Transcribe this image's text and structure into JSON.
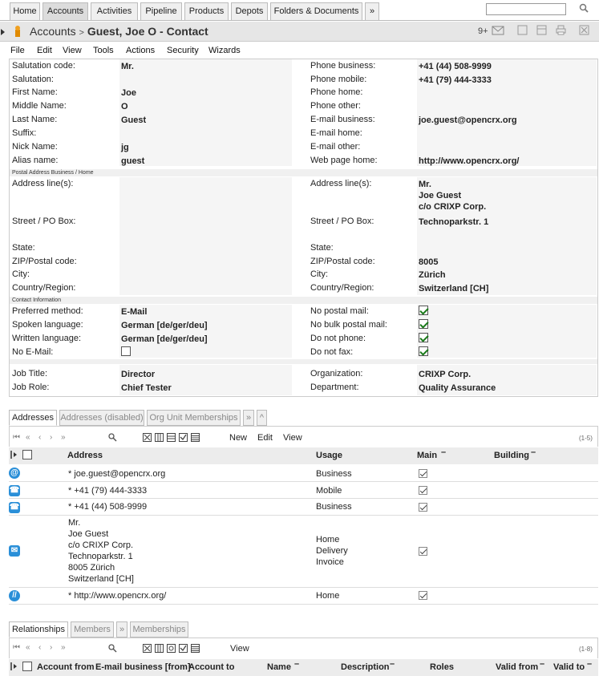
{
  "top_tabs": [
    {
      "label": "Home",
      "active": false
    },
    {
      "label": "Accounts",
      "active": true
    },
    {
      "label": "Activities",
      "active": false
    },
    {
      "label": "Pipeline",
      "active": false
    },
    {
      "label": "Products",
      "active": false
    },
    {
      "label": "Depots",
      "active": false
    },
    {
      "label": "Folders & Documents",
      "active": false
    },
    {
      "label": "»",
      "active": false
    }
  ],
  "search": {
    "value": "",
    "placeholder": ""
  },
  "breadcrumb": {
    "section": "Accounts",
    "separator": ">",
    "object": "Guest, Joe O - Contact"
  },
  "notifications": {
    "count": "9+"
  },
  "menu": [
    "File",
    "Edit",
    "View",
    "Tools",
    "Actions",
    "Security",
    "Wizards"
  ],
  "fields_left": [
    {
      "label": "Salutation code:",
      "value": "Mr."
    },
    {
      "label": "Salutation:",
      "value": ""
    },
    {
      "label": "First Name:",
      "value": "Joe"
    },
    {
      "label": "Middle Name:",
      "value": "O"
    },
    {
      "label": "Last Name:",
      "value": "Guest"
    },
    {
      "label": "Suffix:",
      "value": ""
    },
    {
      "label": "Nick Name:",
      "value": "jg"
    },
    {
      "label": "Alias name:",
      "value": "guest"
    }
  ],
  "fields_right": [
    {
      "label": "Phone business:",
      "value": "+41 (44) 508-9999"
    },
    {
      "label": "Phone mobile:",
      "value": "+41 (79) 444-3333"
    },
    {
      "label": "Phone home:",
      "value": ""
    },
    {
      "label": "Phone other:",
      "value": ""
    },
    {
      "label": "E-mail business:",
      "value": "joe.guest@opencrx.org"
    },
    {
      "label": "E-mail home:",
      "value": ""
    },
    {
      "label": "E-mail other:",
      "value": ""
    },
    {
      "label": "Web page home:",
      "value": "http://www.opencrx.org/"
    }
  ],
  "postal_section": "Postal Address Business / Home",
  "postal_left": [
    {
      "label": "Address line(s):",
      "value": ""
    },
    {
      "label": "Street / PO Box:",
      "value": ""
    },
    {
      "label": "State:",
      "value": ""
    },
    {
      "label": "ZIP/Postal code:",
      "value": ""
    },
    {
      "label": "City:",
      "value": ""
    },
    {
      "label": "Country/Region:",
      "value": ""
    }
  ],
  "postal_right": [
    {
      "label": "Address line(s):",
      "value": "Mr.\nJoe Guest\nc/o CRIXP Corp."
    },
    {
      "label": "Street / PO Box:",
      "value": "Technoparkstr. 1"
    },
    {
      "label": "State:",
      "value": ""
    },
    {
      "label": "ZIP/Postal code:",
      "value": "8005"
    },
    {
      "label": "City:",
      "value": "Zürich"
    },
    {
      "label": "Country/Region:",
      "value": "Switzerland [CH]"
    }
  ],
  "contact_section": "Contact Information",
  "contact_left": [
    {
      "label": "Preferred method:",
      "value": "E-Mail"
    },
    {
      "label": "Spoken language:",
      "value": "German [de/ger/deu]"
    },
    {
      "label": "Written language:",
      "value": "German [de/ger/deu]"
    },
    {
      "label": "No E-Mail:",
      "checked": false
    }
  ],
  "contact_right": [
    {
      "label": "No postal mail:",
      "checked": true
    },
    {
      "label": "No bulk postal mail:",
      "checked": true
    },
    {
      "label": "Do not phone:",
      "checked": true
    },
    {
      "label": "Do not fax:",
      "checked": true
    }
  ],
  "job_left": [
    {
      "label": "Job Title:",
      "value": "Director"
    },
    {
      "label": "Job Role:",
      "value": "Chief Tester"
    }
  ],
  "job_right": [
    {
      "label": "Organization:",
      "value": "CRIXP Corp."
    },
    {
      "label": "Department:",
      "value": "Quality Assurance"
    }
  ],
  "addresses_grid": {
    "tabs": [
      {
        "label": "Addresses",
        "active": true
      },
      {
        "label": "Addresses (disabled)",
        "active": false
      },
      {
        "label": "Org Unit Memberships",
        "active": false
      },
      {
        "label": "»",
        "active": false
      },
      {
        "label": "^",
        "active": false
      }
    ],
    "actions": [
      "New",
      "Edit",
      "View"
    ],
    "count": "(1-5)",
    "columns": {
      "address": "Address",
      "usage": "Usage",
      "main": "Main",
      "building": "Building"
    },
    "rows": [
      {
        "icon": "email",
        "address": "* joe.guest@opencrx.org",
        "usage": "Business",
        "main": true
      },
      {
        "icon": "phone",
        "address": "* +41 (79) 444-3333",
        "usage": "Mobile",
        "main": true
      },
      {
        "icon": "phone",
        "address": "* +41 (44) 508-9999",
        "usage": "Business",
        "main": true
      },
      {
        "icon": "postal",
        "address": "Mr.\nJoe Guest\nc/o CRIXP Corp.\nTechnoparkstr. 1\n8005 Zürich\nSwitzerland [CH]",
        "usage": "Home\nDelivery\nInvoice",
        "main": true
      },
      {
        "icon": "web",
        "address": "* http://www.opencrx.org/",
        "usage": "Home",
        "main": true
      }
    ]
  },
  "relationships_grid": {
    "tabs": [
      {
        "label": "Relationships",
        "active": true
      },
      {
        "label": "Members",
        "active": false
      },
      {
        "label": "»",
        "active": false
      },
      {
        "label": "Memberships",
        "active": false
      }
    ],
    "actions": [
      "View"
    ],
    "count": "(1-8)",
    "columns": [
      "Account from",
      "E-mail business [from]",
      "Account to",
      "Name",
      "Description",
      "Roles",
      "Valid from",
      "Valid to"
    ]
  },
  "colors": {
    "accent": "#2a8fd8",
    "check": "#1a7a1a",
    "titlebar": "#e6e6e6"
  }
}
